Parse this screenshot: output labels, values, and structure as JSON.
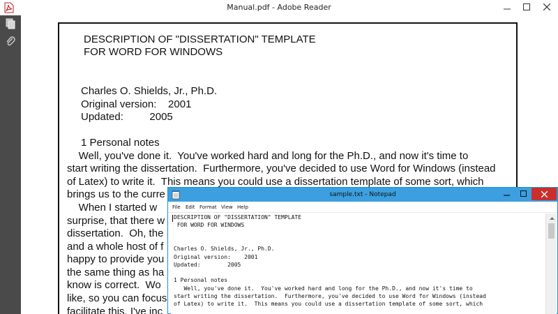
{
  "reader": {
    "title": "Manual.pdf - Adobe Reader",
    "app_icon": "adobe-reader-icon",
    "nav_icons": [
      "pages-icon",
      "attachment-paperclip-icon"
    ],
    "page_lines": [
      "DESCRIPTION OF \"DISSERTATION\" TEMPLATE",
      "FOR WORD FOR WINDOWS",
      "Charles O. Shields, Jr., Ph.D.",
      "Original version:    2001",
      "Updated:         2005",
      "1 Personal notes",
      "    Well, you've done it.  You've worked hard and long for the Ph.D., and now it's time to",
      "start writing the dissertation.  Furthermore, you've decided to use Word for Windows (instead",
      "of Latex) to write it.  This means you could use a dissertation template of some sort, which",
      "brings us to the curre",
      "    When I started w",
      "surprise, that there w",
      "dissertation.  Oh, the",
      "and a whole host of f",
      "happy to provide you",
      "the same thing as ha",
      "know is correct.  Wo",
      "like, so you can focus",
      "facilitate this, I've inc"
    ]
  },
  "notepad": {
    "title": "sample.txt - Notepad",
    "app_icon": "notepad-icon",
    "menu": [
      "File",
      "Edit",
      "Format",
      "View",
      "Help"
    ],
    "lines": [
      "DESCRIPTION OF \"DISSERTATION\" TEMPLATE",
      " FOR WORD FOR WINDOWS",
      "",
      "",
      "Charles O. Shields, Jr., Ph.D.",
      "Original version:    2001",
      "Updated:        2005",
      "",
      "1 Personal notes",
      "   Well, you've done it.  You've worked hard and long for the Ph.D., and now it's time to",
      "start writing the dissertation.  Furthermore, you've decided to use Word for Windows (instead",
      "of Latex) to write it.  This means you could use a dissertation template of some sort, which"
    ]
  },
  "colors": {
    "notepad_title_active": "#3b9fe0",
    "close_red": "#c9302c",
    "reader_nav": "#4a4a4a"
  }
}
